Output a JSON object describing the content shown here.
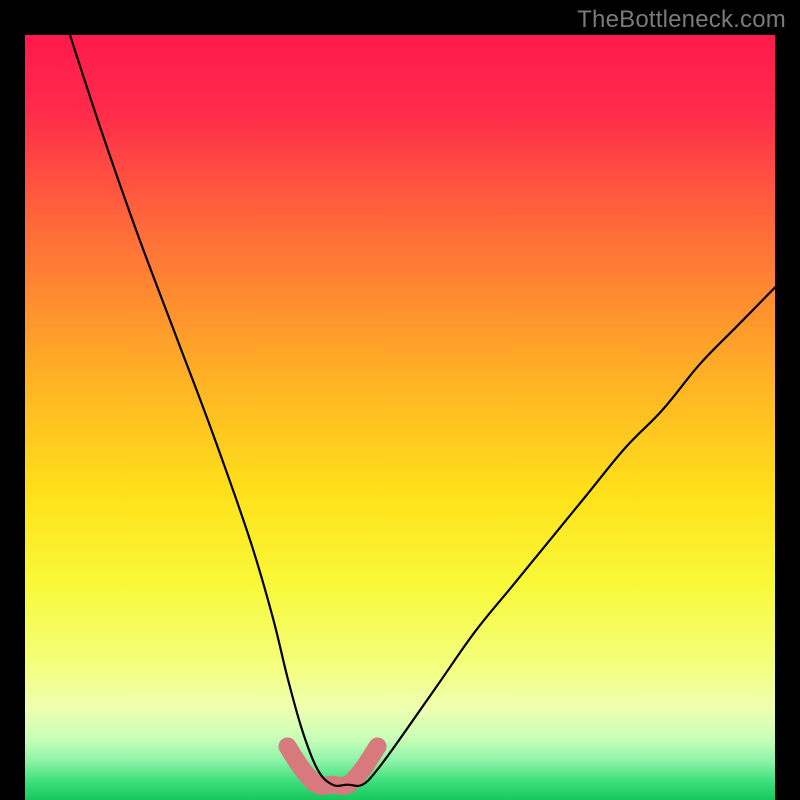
{
  "attribution": "TheBottleneck.com",
  "chart_data": {
    "type": "line",
    "title": "",
    "xlabel": "",
    "ylabel": "",
    "xlim": [
      0,
      100
    ],
    "ylim": [
      0,
      100
    ],
    "series": [
      {
        "name": "bottleneck-curve",
        "x": [
          6,
          10,
          15,
          20,
          25,
          30,
          33,
          35,
          37,
          39,
          41,
          43,
          45,
          47,
          50,
          55,
          60,
          65,
          70,
          75,
          80,
          85,
          90,
          95,
          100
        ],
        "values": [
          100,
          88,
          74,
          61,
          48,
          34,
          24,
          16,
          9,
          4,
          2,
          2,
          2,
          4,
          8,
          15,
          22,
          28,
          34,
          40,
          46,
          51,
          57,
          62,
          67
        ]
      },
      {
        "name": "highlight-band",
        "x": [
          35,
          37,
          39,
          41,
          43,
          45,
          47
        ],
        "values": [
          7,
          4,
          2,
          2,
          2,
          4,
          7
        ]
      }
    ],
    "gradient_stops": [
      {
        "offset": 0.0,
        "color": "#ff1a4b"
      },
      {
        "offset": 0.1,
        "color": "#ff2b4b"
      },
      {
        "offset": 0.25,
        "color": "#ff6a3a"
      },
      {
        "offset": 0.45,
        "color": "#ffb225"
      },
      {
        "offset": 0.6,
        "color": "#ffe11a"
      },
      {
        "offset": 0.72,
        "color": "#f8f93a"
      },
      {
        "offset": 0.82,
        "color": "#f4ff7a"
      },
      {
        "offset": 0.88,
        "color": "#eeffb0"
      },
      {
        "offset": 0.92,
        "color": "#c8ffb8"
      },
      {
        "offset": 0.95,
        "color": "#8af2a8"
      },
      {
        "offset": 0.975,
        "color": "#3fe07b"
      },
      {
        "offset": 1.0,
        "color": "#18c75e"
      }
    ]
  }
}
